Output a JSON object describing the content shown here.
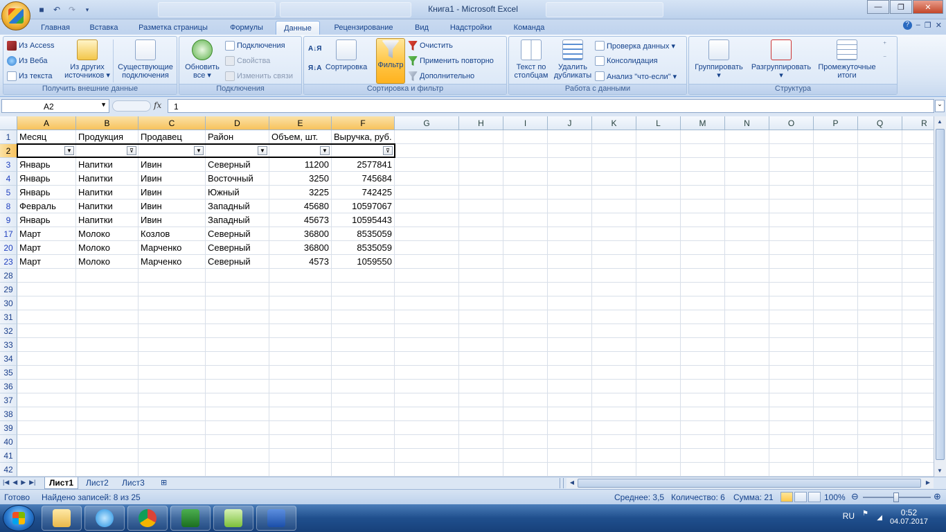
{
  "window": {
    "title": "Книга1 - Microsoft Excel"
  },
  "tabs": [
    {
      "label": "Главная",
      "active": false
    },
    {
      "label": "Вставка",
      "active": false
    },
    {
      "label": "Разметка страницы",
      "active": false
    },
    {
      "label": "Формулы",
      "active": false
    },
    {
      "label": "Данные",
      "active": true
    },
    {
      "label": "Рецензирование",
      "active": false
    },
    {
      "label": "Вид",
      "active": false
    },
    {
      "label": "Надстройки",
      "active": false
    },
    {
      "label": "Команда",
      "active": false
    }
  ],
  "ribbon": {
    "external": {
      "label": "Получить внешние данные",
      "from_access": "Из Access",
      "from_web": "Из Веба",
      "from_text": "Из текста",
      "from_other_1": "Из других",
      "from_other_2": "источников ▾",
      "existing_1": "Существующие",
      "existing_2": "подключения"
    },
    "connections": {
      "label": "Подключения",
      "refresh_1": "Обновить",
      "refresh_2": "все ▾",
      "connections": "Подключения",
      "properties": "Свойства",
      "edit_links": "Изменить связи"
    },
    "sort": {
      "label": "Сортировка и фильтр",
      "sort": "Сортировка",
      "filter": "Фильтр",
      "clear": "Очистить",
      "reapply": "Применить повторно",
      "advanced": "Дополнительно"
    },
    "data_tools": {
      "label": "Работа с данными",
      "text_to_cols_1": "Текст по",
      "text_to_cols_2": "столбцам",
      "remove_dup_1": "Удалить",
      "remove_dup_2": "дубликаты",
      "validation": "Проверка данных ▾",
      "consolidate": "Консолидация",
      "whatif": "Анализ \"что-если\" ▾"
    },
    "outline": {
      "label": "Структура",
      "group": "Группировать",
      "ungroup": "Разгруппировать",
      "subtotal_1": "Промежуточные",
      "subtotal_2": "итоги"
    }
  },
  "formula_bar": {
    "name_box": "A2",
    "fx": "fx",
    "content": "1"
  },
  "columns": [
    "A",
    "B",
    "C",
    "D",
    "E",
    "F",
    "G",
    "H",
    "I",
    "J",
    "K",
    "L",
    "M",
    "N",
    "O",
    "P",
    "Q",
    "R"
  ],
  "header_row": [
    "Месяц",
    "Продукция",
    "Продавец",
    "Район",
    "Объем, шт.",
    "Выручка, руб."
  ],
  "rows": [
    {
      "num": "3",
      "cells": [
        "Январь",
        "Напитки",
        "Ивин",
        "Северный",
        "11200",
        "2577841"
      ]
    },
    {
      "num": "4",
      "cells": [
        "Январь",
        "Напитки",
        "Ивин",
        "Восточный",
        "3250",
        "745684"
      ]
    },
    {
      "num": "5",
      "cells": [
        "Январь",
        "Напитки",
        "Ивин",
        "Южный",
        "3225",
        "742425"
      ]
    },
    {
      "num": "8",
      "cells": [
        "Февраль",
        "Напитки",
        "Ивин",
        "Западный",
        "45680",
        "10597067"
      ]
    },
    {
      "num": "9",
      "cells": [
        "Январь",
        "Напитки",
        "Ивин",
        "Западный",
        "45673",
        "10595443"
      ]
    },
    {
      "num": "17",
      "cells": [
        "Март",
        "Молоко",
        "Козлов",
        "Северный",
        "36800",
        "8535059"
      ]
    },
    {
      "num": "20",
      "cells": [
        "Март",
        "Молоко",
        "Марченко",
        "Северный",
        "36800",
        "8535059"
      ]
    },
    {
      "num": "23",
      "cells": [
        "Март",
        "Молоко",
        "Марченко",
        "Северный",
        "4573",
        "1059550"
      ]
    }
  ],
  "empty_rows": [
    "28",
    "29",
    "30",
    "31",
    "32",
    "33",
    "34",
    "35",
    "36",
    "37",
    "38",
    "39",
    "40",
    "41",
    "42"
  ],
  "sheets": [
    {
      "label": "Лист1",
      "active": true
    },
    {
      "label": "Лист2",
      "active": false
    },
    {
      "label": "Лист3",
      "active": false
    }
  ],
  "status": {
    "ready": "Готово",
    "found": "Найдено записей: 8 из 25",
    "average": "Среднее: 3,5",
    "count": "Количество: 6",
    "sum": "Сумма: 21",
    "zoom": "100%"
  },
  "tray": {
    "lang": "RU",
    "time": "0:52",
    "date": "04.07.2017"
  },
  "colors": {
    "accent": "#15428b",
    "selected_header": "#f7c25d",
    "taskbar": "#1f4f8d"
  }
}
